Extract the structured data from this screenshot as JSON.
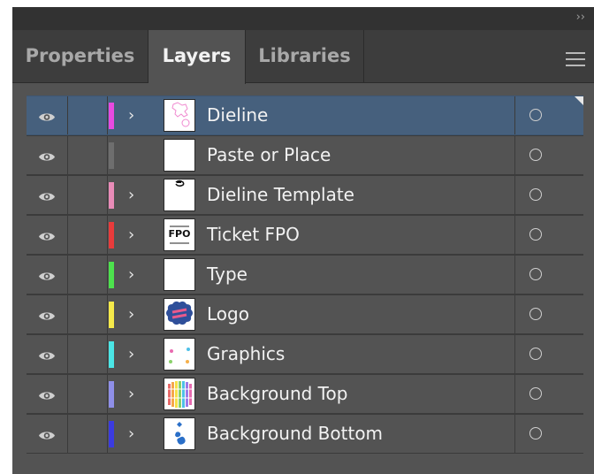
{
  "panel": {
    "collapse_glyph": "››",
    "menu_icon": "hamburger-menu-icon"
  },
  "tabs": [
    {
      "label": "Properties",
      "active": false
    },
    {
      "label": "Layers",
      "active": true
    },
    {
      "label": "Libraries",
      "active": false
    }
  ],
  "layers": [
    {
      "name": "Dieline",
      "color": "#e84ae0",
      "has_children": true,
      "selected": true,
      "visible": true,
      "thumbnail": "dieline-thumbnail"
    },
    {
      "name": "Paste or Place",
      "color": "#6e6e6e",
      "has_children": false,
      "selected": false,
      "visible": true,
      "thumbnail": "blank-thumbnail"
    },
    {
      "name": "Dieline Template",
      "color": "#e98cb8",
      "has_children": true,
      "selected": false,
      "visible": true,
      "thumbnail": "template-thumbnail"
    },
    {
      "name": "Ticket FPO",
      "color": "#e83b3b",
      "has_children": true,
      "selected": false,
      "visible": true,
      "thumbnail": "ticket-thumbnail",
      "thumb_text": "FPO"
    },
    {
      "name": "Type",
      "color": "#4de24d",
      "has_children": true,
      "selected": false,
      "visible": true,
      "thumbnail": "blank-thumbnail"
    },
    {
      "name": "Logo",
      "color": "#f5e94a",
      "has_children": true,
      "selected": false,
      "visible": true,
      "thumbnail": "logo-thumbnail"
    },
    {
      "name": "Graphics",
      "color": "#4be6e6",
      "has_children": true,
      "selected": false,
      "visible": true,
      "thumbnail": "graphics-thumbnail"
    },
    {
      "name": "Background Top",
      "color": "#8f8fe8",
      "has_children": true,
      "selected": false,
      "visible": true,
      "thumbnail": "stripes-thumbnail"
    },
    {
      "name": "Background Bottom",
      "color": "#3b3be0",
      "has_children": true,
      "selected": false,
      "visible": true,
      "thumbnail": "shapes-thumbnail"
    }
  ],
  "icons": {
    "visibility": "eye-icon",
    "expand": "chevron-right-icon",
    "target": "target-circle-icon"
  },
  "chevron_glyph": "›"
}
